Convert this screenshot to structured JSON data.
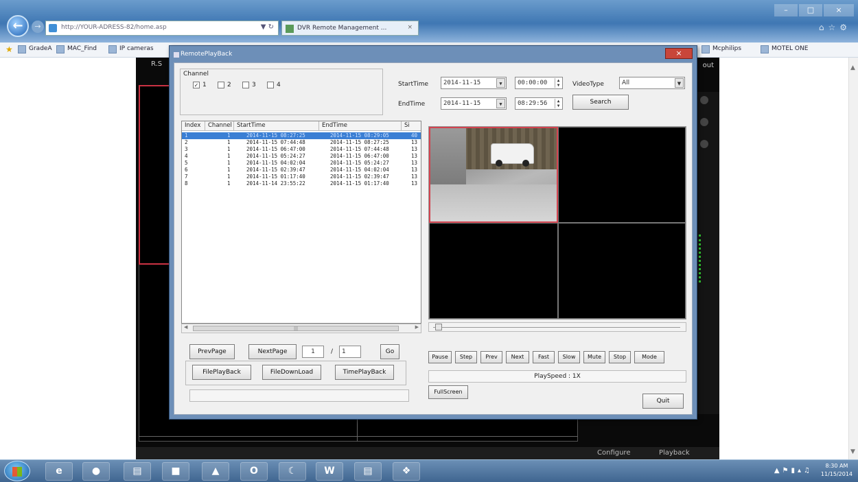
{
  "browser": {
    "address": "http://YOUR-ADRESS-82/home.asp",
    "tab_title": "DVR Remote Management ...",
    "favorites": [
      "GradeA",
      "MAC_Find",
      "IP cameras",
      "Mcphilips",
      "MOTEL ONE"
    ]
  },
  "dvr": {
    "title_fragment": "R.S",
    "out_fragment": "out",
    "bottom_configure": "Configure",
    "bottom_playback": "Playback"
  },
  "dialog": {
    "title": "RemotePlayBack",
    "channel": {
      "label": "Channel",
      "options": [
        {
          "label": "1",
          "checked": true
        },
        {
          "label": "2",
          "checked": false
        },
        {
          "label": "3",
          "checked": false
        },
        {
          "label": "4",
          "checked": false
        }
      ]
    },
    "start_time_label": "StartTime",
    "start_date": "2014-11-15",
    "start_clock": "00:00:00",
    "end_time_label": "EndTime",
    "end_date": "2014-11-15",
    "end_clock": "08:29:56",
    "video_type_label": "VideoType",
    "video_type_value": "All",
    "search_button": "Search",
    "list": {
      "columns": [
        "Index",
        "Channel",
        "StartTime",
        "EndTime",
        "Si"
      ],
      "rows": [
        {
          "index": "1",
          "channel": "1",
          "start": "2014-11-15 08:27:25",
          "end": "2014-11-15 08:29:05",
          "size": "40",
          "selected": true
        },
        {
          "index": "2",
          "channel": "1",
          "start": "2014-11-15 07:44:48",
          "end": "2014-11-15 08:27:25",
          "size": "13"
        },
        {
          "index": "3",
          "channel": "1",
          "start": "2014-11-15 06:47:00",
          "end": "2014-11-15 07:44:48",
          "size": "13"
        },
        {
          "index": "4",
          "channel": "1",
          "start": "2014-11-15 05:24:27",
          "end": "2014-11-15 06:47:00",
          "size": "13"
        },
        {
          "index": "5",
          "channel": "1",
          "start": "2014-11-15 04:02:04",
          "end": "2014-11-15 05:24:27",
          "size": "13"
        },
        {
          "index": "6",
          "channel": "1",
          "start": "2014-11-15 02:39:47",
          "end": "2014-11-15 04:02:04",
          "size": "13"
        },
        {
          "index": "7",
          "channel": "1",
          "start": "2014-11-15 01:17:40",
          "end": "2014-11-15 02:39:47",
          "size": "13"
        },
        {
          "index": "8",
          "channel": "1",
          "start": "2014-11-14 23:55:22",
          "end": "2014-11-15 01:17:40",
          "size": "13"
        }
      ]
    },
    "prev_page": "PrevPage",
    "next_page": "NextPage",
    "page_current": "1",
    "page_separator": "/",
    "page_total": "1",
    "go_button": "Go",
    "file_playback": "FilePlayBack",
    "file_download": "FileDownLoad",
    "time_playback": "TimePlayBack",
    "controls": [
      "Pause",
      "Step",
      "Prev",
      "Next",
      "Fast",
      "Slow",
      "Mute",
      "Stop",
      "Mode"
    ],
    "play_speed": "PlaySpeed : 1X",
    "fullscreen": "FullScreen",
    "quit": "Quit",
    "progress": 0.02
  },
  "taskbar": {
    "time": "8:30 AM",
    "date": "11/15/2014"
  }
}
